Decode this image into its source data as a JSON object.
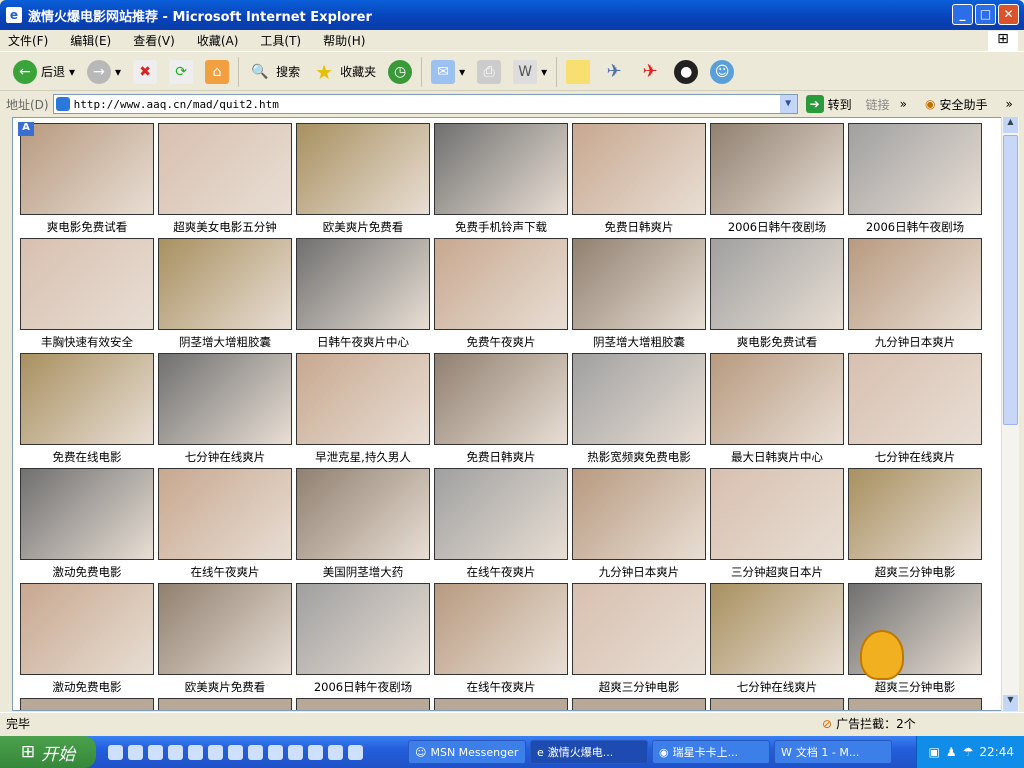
{
  "window": {
    "title": "激情火爆电影网站推荐 - Microsoft Internet Explorer"
  },
  "menu": [
    "文件(F)",
    "编辑(E)",
    "查看(V)",
    "收藏(A)",
    "工具(T)",
    "帮助(H)"
  ],
  "toolbar": {
    "back": "后退",
    "search": "搜索",
    "favorites": "收藏夹"
  },
  "address": {
    "label": "地址(D)",
    "url": "http://www.aaq.cn/mad/quit2.htm",
    "go": "转到",
    "links": "链接",
    "safety": "安全助手"
  },
  "grid": [
    [
      "爽电影免费试看",
      "超爽美女电影五分钟",
      "欧美爽片免费看",
      "免费手机铃声下载",
      "免费日韩爽片",
      "2006日韩午夜剧场",
      "2006日韩午夜剧场"
    ],
    [
      "丰胸快速有效安全",
      "阴茎增大增粗胶囊",
      "日韩午夜爽片中心",
      "免费午夜爽片",
      "阴茎增大增粗胶囊",
      "爽电影免费试看",
      "九分钟日本爽片"
    ],
    [
      "免费在线电影",
      "七分钟在线爽片",
      "早泄克星,持久男人",
      "免费日韩爽片",
      "热影宽频爽免费电影",
      "最大日韩爽片中心",
      "七分钟在线爽片"
    ],
    [
      "激动免费电影",
      "在线午夜爽片",
      "美国阴茎增大药",
      "在线午夜爽片",
      "九分钟日本爽片",
      "三分钟超爽日本片",
      "超爽三分钟电影"
    ],
    [
      "激动免费电影",
      "欧美爽片免费看",
      "2006日韩午夜剧场",
      "在线午夜爽片",
      "超爽三分钟电影",
      "七分钟在线爽片",
      "超爽三分钟电影"
    ]
  ],
  "thumb_colors": [
    "#b89a80",
    "#d8c0b0",
    "#a89060",
    "#707070",
    "#c8a890",
    "#908070",
    "#a0a0a0"
  ],
  "status": {
    "text": "完毕",
    "ads_blocked": "广告拦截：2个"
  },
  "taskbar": {
    "start": "开始",
    "tasks": [
      "MSN Messenger",
      "激情火爆电...",
      "瑞星卡卡上...",
      "文档 1 - M..."
    ],
    "clock": "22:44"
  }
}
